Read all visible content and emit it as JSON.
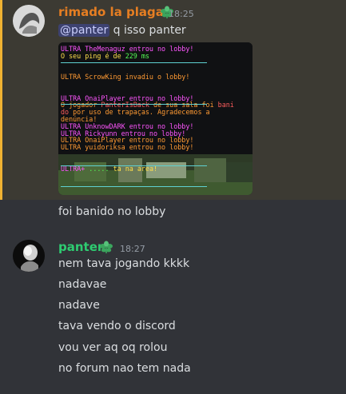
{
  "messages": [
    {
      "author": "rimado la plaga",
      "time": "18:25",
      "text_prefix": "q isso panter",
      "mention": "@panter",
      "highlighted": true,
      "screenshot": {
        "lines": [
          {
            "tag": "ULTRA",
            "text": " TheMenaguz entrou no lobby!"
          },
          {
            "tag": "",
            "text": "O seu ping é de ",
            "value": "229 ms"
          },
          {
            "tag": "ULTRA",
            "text": "  ScrowKing invadiu o lobby!"
          },
          {
            "tag": "ULTRA",
            "text": " OnaiPlayer entrou no lobby!"
          },
          {
            "tag": "",
            "text": "O jogador ",
            "player": "PanterIsBack",
            "rest": " de sua sala foi bani"
          },
          {
            "tag": "",
            "text": "do por uso de trapaças. Agradecemos a"
          },
          {
            "tag": "",
            "text": " denúncia!"
          },
          {
            "tag": "ULTRA",
            "text": " UnknowDARK entrou no lobby!"
          },
          {
            "tag": "ULTRA",
            "text": " Rickyunn entrou no lobby!"
          },
          {
            "tag": "ULTRA",
            "text": " OnaiPlayer entrou no lobby!"
          },
          {
            "tag": "ULTRA",
            "text": " yuidoriksa entrou no lobby!"
          },
          {
            "tag": "ULTRA+",
            "text": " .....  tá na área!"
          }
        ]
      },
      "followup": "foi banido no lobby"
    },
    {
      "author": "panter",
      "time": "18:27",
      "lines": [
        "nem tava jogando kkkk",
        "nadavae",
        "nadave",
        "tava vendo o discord",
        "vou ver aq oq rolou",
        "no forum nao tem nada"
      ]
    }
  ],
  "colors": {
    "background": "#313338",
    "highlight": "#3c3a33",
    "highlight_bar": "#f0b232",
    "author1": "#e67e22",
    "author2": "#2ecc71",
    "mention_bg": "#3d4270"
  },
  "icons": {
    "author_badge": "green-leaf-badge-icon"
  }
}
